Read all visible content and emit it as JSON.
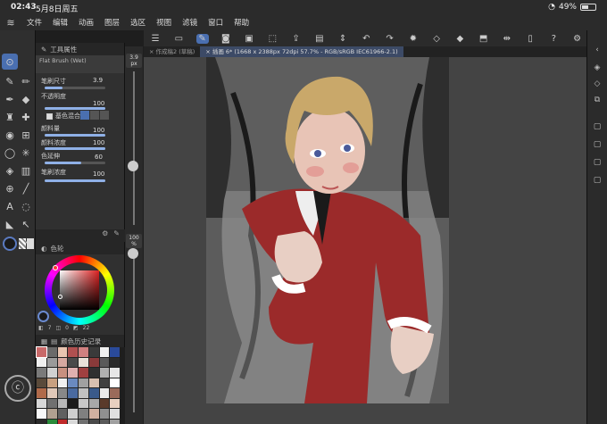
{
  "status": {
    "time": "02:43",
    "date": "5月8日周五",
    "battery": "49%",
    "battery_level": 0.49
  },
  "menu": [
    "文件",
    "编辑",
    "动画",
    "图层",
    "选区",
    "视图",
    "滤镜",
    "窗口",
    "帮助"
  ],
  "tool_panel": {
    "header": "工具属性",
    "brush_name": "Flat Brush (Wet)",
    "size_label": "笔刷尺寸",
    "size_value": "3.9",
    "opacity_label": "不透明度",
    "opacity_value": "100",
    "blend_label": "基色混合",
    "paint_amount_label": "颜料量",
    "paint_amount_value": "100",
    "paint_density_label": "颜料浓度",
    "paint_density_value": "100",
    "color_stretch_label": "色延伸",
    "color_stretch_value": "60",
    "brush_density_label": "笔刷浓度",
    "brush_density_value": "100"
  },
  "size_indicator": "3.9",
  "size_unit": "px",
  "zoom_indicator": "100",
  "zoom_unit": "%",
  "color_panel": {
    "header": "色轮",
    "h": "7",
    "s": "0",
    "v": "22"
  },
  "history_panel": {
    "header": "颜色历史记录"
  },
  "tabs": [
    "作成稿2 (草稿)",
    "插画 6* (1668 x 2388px 72dpi 57.7% - RGB/sRGB IEC61966-2.1)"
  ],
  "palette": [
    "#c96a6a",
    "#6a6a6a",
    "#e8c4b0",
    "#b05050",
    "#d08080",
    "#3a3a3a",
    "#f0f0f0",
    "#2a4a9a",
    "#f0f0f0",
    "#9a9a9a",
    "#d6a8a0",
    "#4a4a4a",
    "#e8e0d8",
    "#8a3a3a",
    "#5a5a5a",
    "#2a2a2a",
    "#7a7a7a",
    "#d0d0d0",
    "#c89080",
    "#e0b0b0",
    "#a04040",
    "#303030",
    "#b0b0b0",
    "#e6e6e6",
    "#5a4a3a",
    "#c8a080",
    "#f0f0f0",
    "#6a8ac0",
    "#a0a0a0",
    "#d8c0b0",
    "#404040",
    "#ffffff",
    "#b06a4a",
    "#e0c8b8",
    "#888888",
    "#4a6aa0",
    "#c0c0c0",
    "#3a5a8a",
    "#eaeaea",
    "#9a6a5a",
    "#d8d8d8",
    "#707070",
    "#b8b8b8",
    "#1a1a1a",
    "#c8c8c8",
    "#a8a8a8",
    "#5a3a2a",
    "#e8d0c0",
    "#f8f8f8",
    "#b0a090",
    "#606060",
    "#cfcfcf",
    "#808080",
    "#d0b0a0",
    "#909090",
    "#e0e0e0",
    "#2a2a2a",
    "#2a8a3a",
    "#c02a2a",
    "#d8d8d8",
    "#707070",
    "#4a4a4a",
    "#5a5a5a",
    "#a0a0a0"
  ]
}
